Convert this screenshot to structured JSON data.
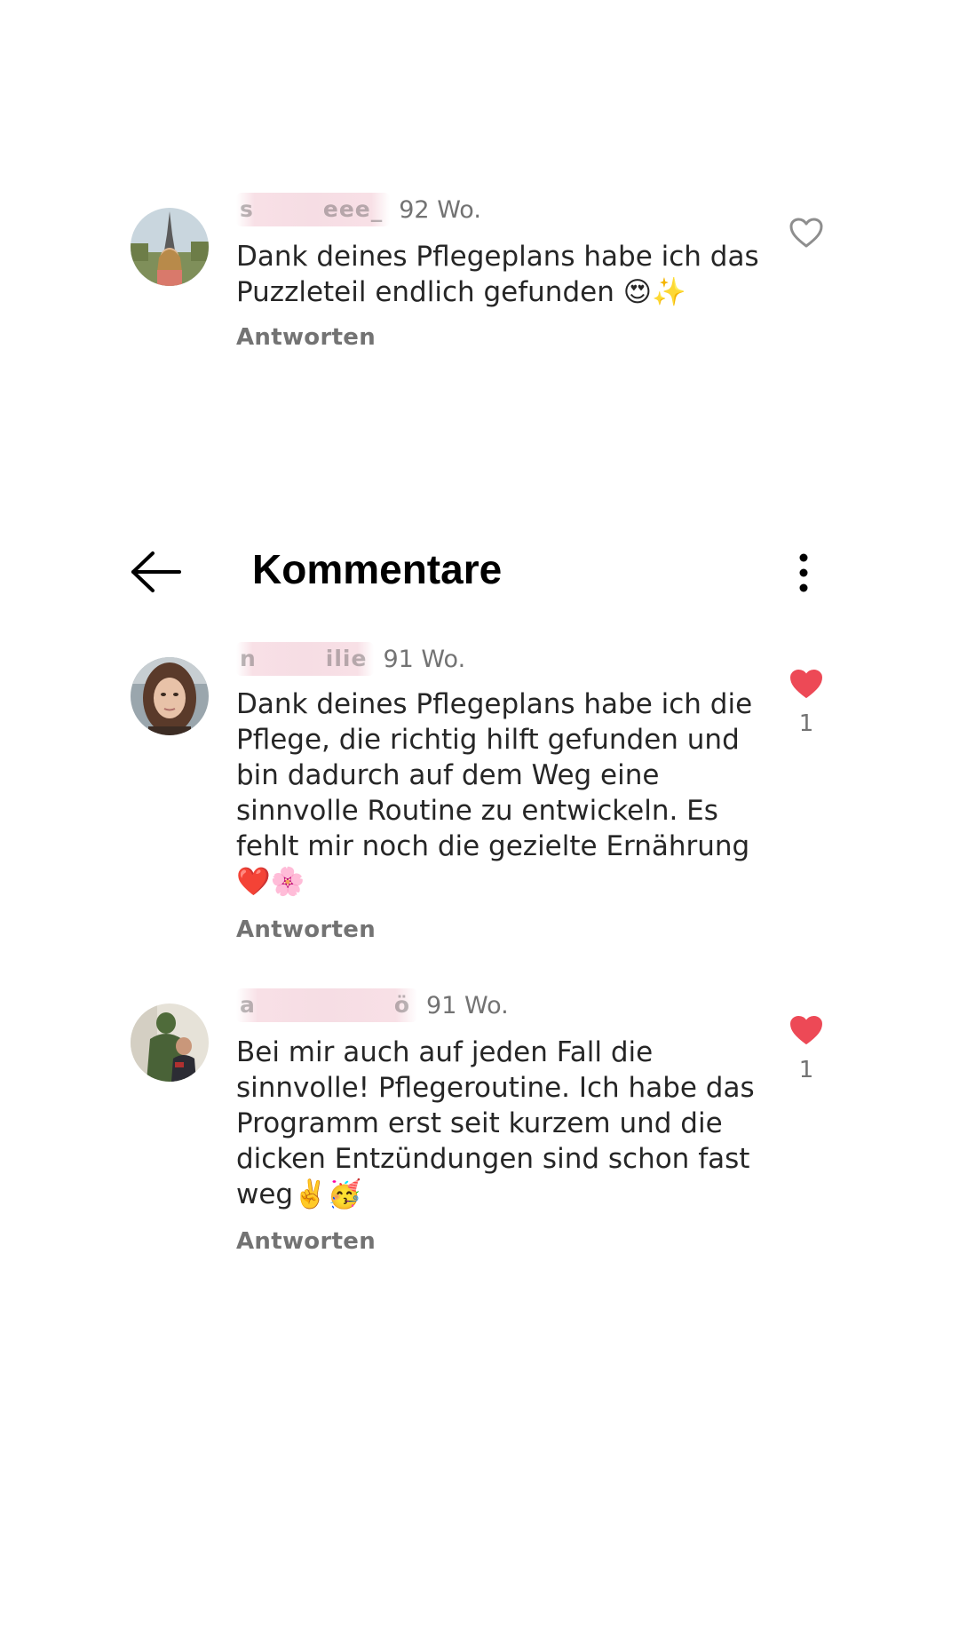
{
  "header": {
    "title": "Kommentare",
    "back_icon": "arrow-left-icon",
    "menu_icon": "more-vertical-icon"
  },
  "comments": [
    {
      "username": "s   eee_",
      "time": "92 Wo.",
      "text": "Dank deines Pflegeplans habe ich das Puzzleteil endlich gefunden 😍✨",
      "reply_label": "Antworten",
      "liked": false,
      "like_count": ""
    },
    {
      "username": "n   ilie",
      "time": "91 Wo.",
      "text": "Dank deines Pflegeplans habe ich die Pflege, die richtig hilft gefunden und bin dadurch auf dem Weg eine sinnvolle Routine zu entwickeln. Es fehlt mir noch die gezielte Ernährung ❤️🌸",
      "reply_label": "Antworten",
      "liked": true,
      "like_count": "1"
    },
    {
      "username": "a      ö",
      "time": "91 Wo.",
      "text": "Bei mir auch auf jeden Fall die sinnvolle! Pflegeroutine. Ich habe das Programm erst seit kurzem und die dicken Entzündungen sind schon fast weg✌️🥳",
      "reply_label": "Antworten",
      "liked": true,
      "like_count": "1"
    }
  ],
  "colors": {
    "like_red": "#ed4956",
    "text": "#262626",
    "muted": "#737373"
  }
}
